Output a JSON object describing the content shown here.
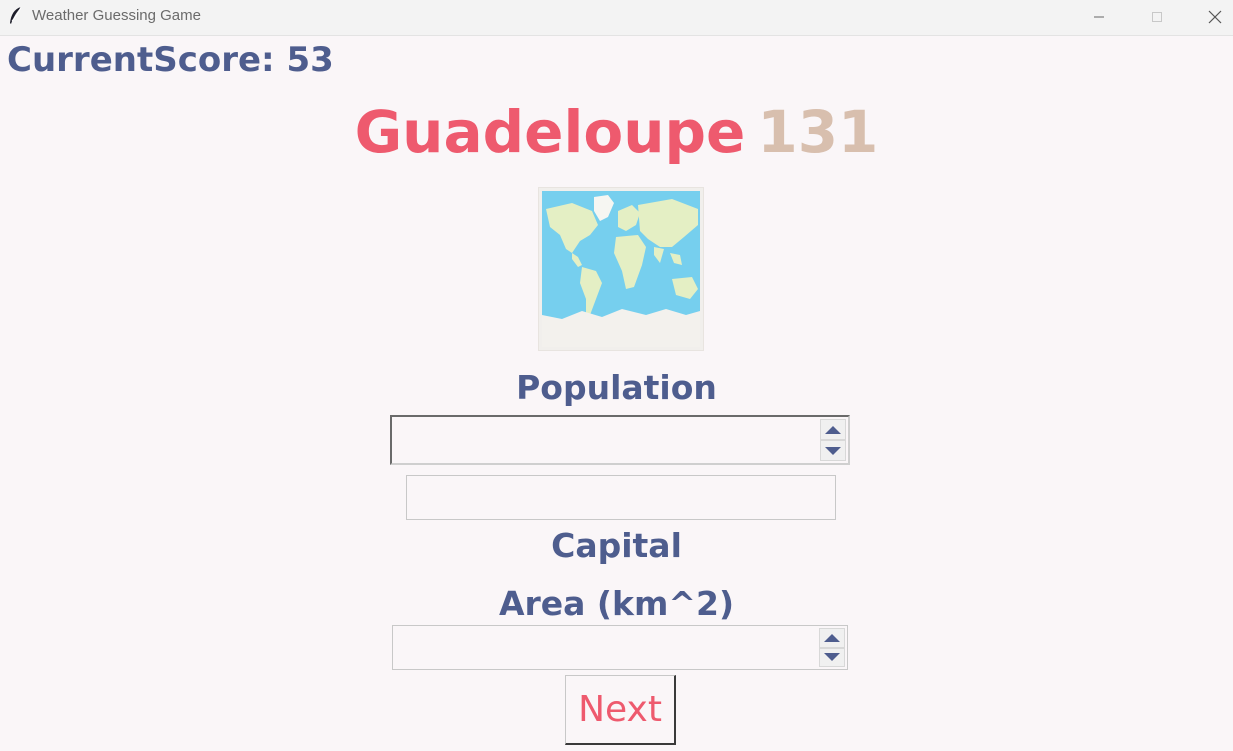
{
  "window": {
    "title": "Weather Guessing Game"
  },
  "score": {
    "text": "CurrentScore: 53"
  },
  "country": {
    "name": "Guadeloupe",
    "number": "131"
  },
  "labels": {
    "population": "Population",
    "capital": "Capital",
    "area": "Area (km^2)"
  },
  "inputs": {
    "population_value": "",
    "capital_value": "",
    "area_value": ""
  },
  "buttons": {
    "next": "Next"
  },
  "colors": {
    "accent_text": "#4e5d8e",
    "country_name": "#ee5a6e",
    "country_number": "#d8bfae",
    "next_text": "#ee5a6e",
    "background": "#faf6f8"
  }
}
